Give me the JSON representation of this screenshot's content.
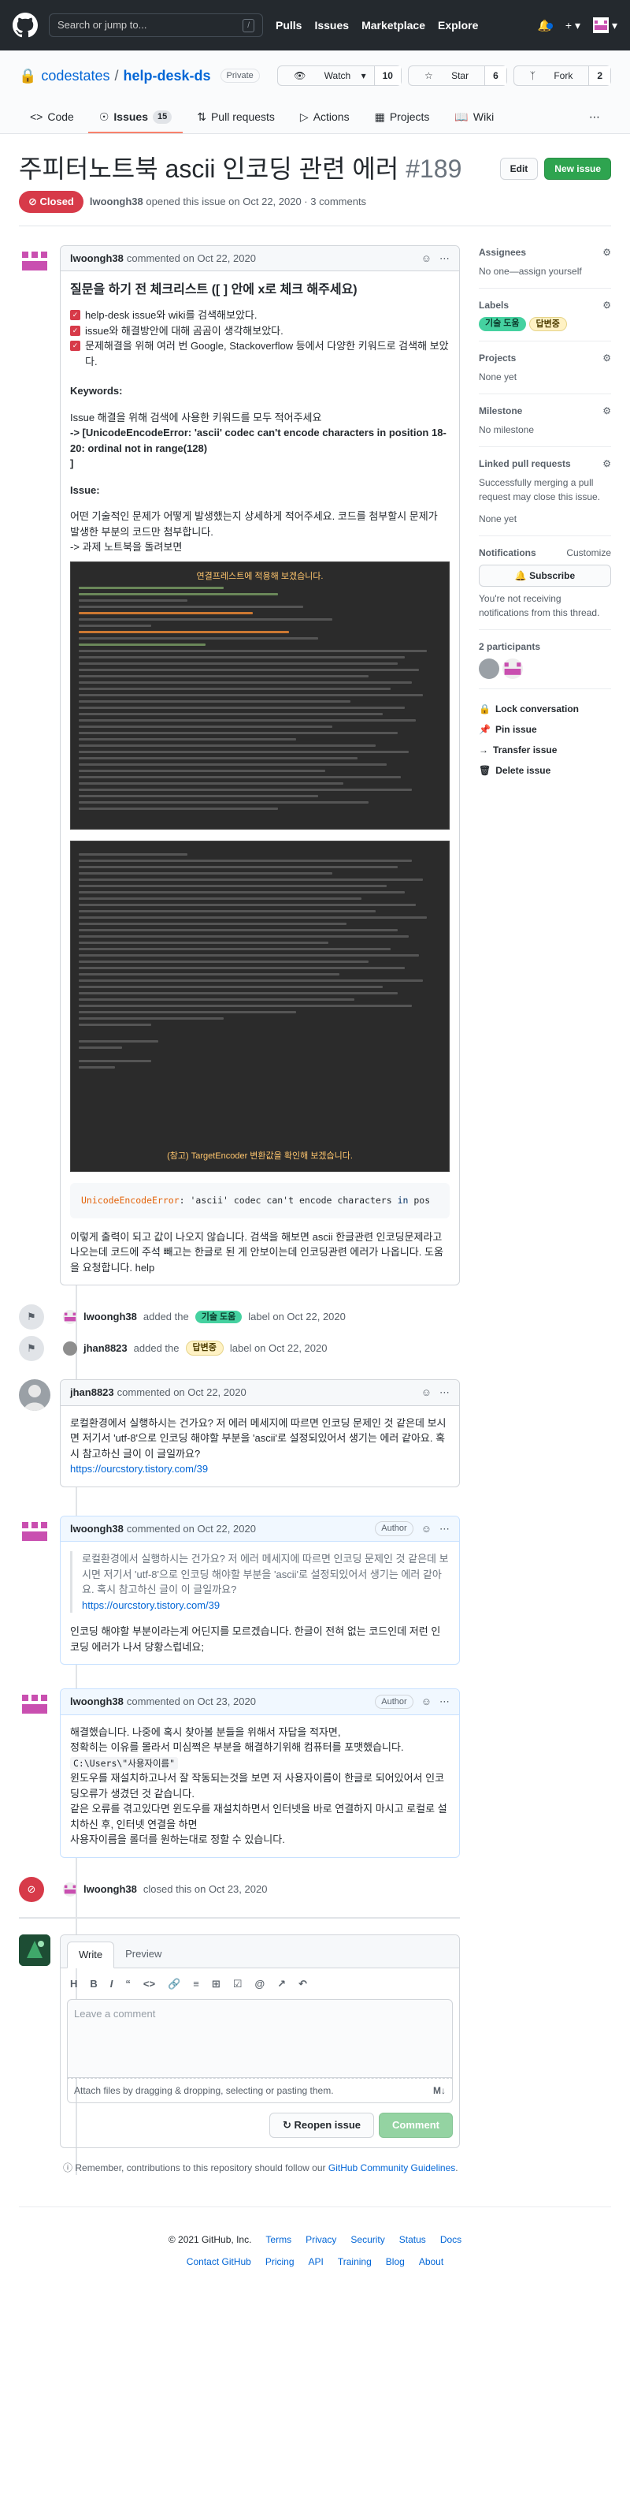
{
  "header": {
    "search_placeholder": "Search or jump to...",
    "search_key": "/",
    "nav": [
      "Pulls",
      "Issues",
      "Marketplace",
      "Explore"
    ]
  },
  "repo": {
    "owner": "codestates",
    "name": "help-desk-ds",
    "visibility": "Private",
    "watch_label": "Watch",
    "watch_count": "10",
    "star_label": "Star",
    "star_count": "6",
    "fork_label": "Fork",
    "fork_count": "2",
    "tabs": [
      {
        "label": "Code"
      },
      {
        "label": "Issues",
        "count": "15"
      },
      {
        "label": "Pull requests"
      },
      {
        "label": "Actions"
      },
      {
        "label": "Projects"
      },
      {
        "label": "Wiki"
      }
    ]
  },
  "issue": {
    "title": "주피터노트북 ascii 인코딩 관련 에러",
    "number": "#189",
    "edit_label": "Edit",
    "new_issue_label": "New issue",
    "state": "Closed",
    "author": "lwoongh38",
    "opened_text": "opened this issue on Oct 22, 2020 · 3 comments"
  },
  "first_comment": {
    "author": "lwoongh38",
    "meta": "commented on Oct 22, 2020",
    "heading": "질문을 하기 전 체크리스트 ([ ] 안에 x로 체크 해주세요)",
    "tasks": [
      "help-desk issue와 wiki를 검색해보았다.",
      "issue와 해결방안에 대해 곰곰이 생각해보았다.",
      "문제해결을 위해 여러 번 Google, Stackoverflow 등에서 다양한 키워드로 검색해 보았다."
    ],
    "keywords_label": "Keywords:",
    "keywords_desc": "Issue 해결을 위해 검색에 사용한 키워드를 모두 적어주세요",
    "keywords_value": "-> [UnicodeEncodeError: 'ascii' codec can't encode characters in position 18-20: ordinal not in range(128)",
    "keywords_close": "]",
    "issue_label": "Issue:",
    "issue_desc": "어떤 기술적인 문제가 어떻게 발생했는지 상세하게 적어주세요. 코드를 첨부할시 문제가 발생한 부분의 코드만 첨부합니다.",
    "issue_sub": "-> 과제 노트북을 돌려보면",
    "shot1_caption": "연결프레스트에 적용해 보겠습니다.",
    "shot2_caption": "(참고) TargetEncoder 변환값을 확인해 보겠습니다.",
    "code_error": "UnicodeEncodeError",
    "code_rest": ": 'ascii' codec can't encode characters ",
    "code_kw": "in",
    "code_tail": " pos",
    "closing": "이렇게 출력이 되고 값이 나오지 않습니다. 검색을 해보면 ascii 한글관련 인코딩문제라고 나오는데 코드에 주석 빼고는 한글로 된 게 안보이는데 인코딩관련 에러가 나옵니다. 도움을 요청합니다. help"
  },
  "events": [
    {
      "actor": "lwoongh38",
      "pre": "added the",
      "label": "기술 도움",
      "post": "label on Oct 22, 2020"
    },
    {
      "actor": "jhan8823",
      "pre": "added the",
      "label": "답변중",
      "post": "label on Oct 22, 2020"
    }
  ],
  "comments": [
    {
      "author": "jhan8823",
      "meta": "commented on Oct 22, 2020",
      "body": "로컬환경에서 실행하시는 건가요? 저 에러 메세지에 따르면 인코딩 문제인 것 같은데 보시면 저기서 'utf-8'으로 인코딩 해야할 부분을 'ascii'로 설정되있어서 생기는 에러 같아요. 혹시 참고하신 글이 이 글일까요?",
      "link": "https://ourcstory.tistory.com/39"
    },
    {
      "author": "lwoongh38",
      "meta": "commented on Oct 22, 2020",
      "badge": "Author",
      "quote": "로컬환경에서 실행하시는 건가요? 저 에러 메세지에 따르면 인코딩 문제인 것 같은데 보시면 저기서 'utf-8'으로 인코딩 해야할 부분을 'ascii'로 설정되있어서 생기는 에러 같아요. 혹시 참고하신 글이 이 글일까요?",
      "quote_link": "https://ourcstory.tistory.com/39",
      "body": "인코딩 해야할 부분이라는게 어딘지를 모르겠습니다. 한글이 전혀 없는 코드인데 저런 인코딩 에러가 나서 당황스럽네요;"
    },
    {
      "author": "lwoongh38",
      "meta": "commented on Oct 23, 2020",
      "badge": "Author",
      "line1": "해결했습니다. 나중에 혹시 찾아볼 분들을 위해서 자답을 적자면,",
      "line2": "정확히는 이유를 몰라서 미심쩍은 부분을 해결하기위해 컴퓨터를 포맷했습니다.",
      "path": "C:\\Users\\\"사용자이름\"",
      "line3": "윈도우를 재설치하고나서 잘 작동되는것을 보면 저 사용자이름이 한글로 되어있어서 인코딩오류가 생겼던 것 같습니다.",
      "line4": "같은 오류를 겪고있다면 윈도우를 재설치하면서 인터넷을 바로 연결하지 마시고 로컬로 설치하신 후, 인터넷 연결을 하면",
      "line5": "사용자이름을 롤더를 원하는대로 정할 수 있습니다."
    }
  ],
  "close_event": {
    "actor": "lwoongh38",
    "text": "closed this on Oct 23, 2020"
  },
  "editor": {
    "tab_write": "Write",
    "tab_preview": "Preview",
    "placeholder": "Leave a comment",
    "attach": "Attach files by dragging & dropping, selecting or pasting them.",
    "reopen": "Reopen issue",
    "comment": "Comment"
  },
  "guidelines": {
    "text": "Remember, contributions to this repository should follow our",
    "link": "GitHub Community Guidelines",
    "end": "."
  },
  "sidebar": {
    "assignees_title": "Assignees",
    "assignees_value": "No one—assign yourself",
    "labels_title": "Labels",
    "labels": [
      "기술 도움",
      "답변중"
    ],
    "projects_title": "Projects",
    "projects_value": "None yet",
    "milestone_title": "Milestone",
    "milestone_value": "No milestone",
    "linked_title": "Linked pull requests",
    "linked_desc": "Successfully merging a pull request may close this issue.",
    "linked_value": "None yet",
    "notif_title": "Notifications",
    "notif_customize": "Customize",
    "subscribe": "Subscribe",
    "notif_desc": "You're not receiving notifications from this thread.",
    "participants": "2 participants",
    "actions": [
      "Lock conversation",
      "Pin issue",
      "Transfer issue",
      "Delete issue"
    ]
  },
  "footer": {
    "row1": [
      "© 2021 GitHub, Inc.",
      "Terms",
      "Privacy",
      "Security",
      "Status",
      "Docs"
    ],
    "row2": [
      "Contact GitHub",
      "Pricing",
      "API",
      "Training",
      "Blog",
      "About"
    ]
  }
}
